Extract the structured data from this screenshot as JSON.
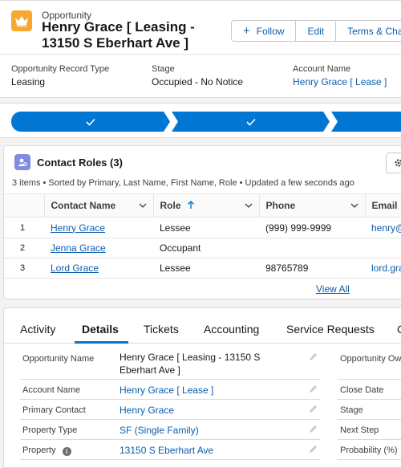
{
  "header": {
    "object_label": "Opportunity",
    "title": "Henry Grace [ Leasing - 13150 S Eberhart Ave ]",
    "buttons": {
      "follow": "Follow",
      "edit": "Edit",
      "terms": "Terms & Cha"
    },
    "fields": [
      {
        "label": "Opportunity Record Type",
        "value": "Leasing"
      },
      {
        "label": "Stage",
        "value": "Occupied - No Notice"
      },
      {
        "label": "Account Name",
        "value": "Henry Grace [ Lease ]"
      }
    ],
    "icon": "crown-icon",
    "accent_color": "#f6a830"
  },
  "path": {
    "steps_complete": 3,
    "color": "#0176d3"
  },
  "contact_roles": {
    "title": "Contact Roles (3)",
    "meta": "3 items • Sorted by Primary, Last Name, First Name, Role • Updated a few seconds ago",
    "columns": [
      "Contact Name",
      "Role",
      "Phone",
      "Email"
    ],
    "rows": [
      {
        "num": "1",
        "name": "Henry Grace",
        "role": "Lessee",
        "phone": "(999) 999-9999",
        "email": "henry@"
      },
      {
        "num": "2",
        "name": "Jenna Grace",
        "role": "Occupant",
        "phone": "",
        "email": ""
      },
      {
        "num": "3",
        "name": "Lord Grace",
        "role": "Lessee",
        "phone": "98765789",
        "email": "lord.gra"
      }
    ],
    "view_all": "View All",
    "icon_color": "#7f8de1"
  },
  "details": {
    "tabs": [
      "Activity",
      "Details",
      "Tickets",
      "Accounting",
      "Service Requests",
      "C"
    ],
    "active_tab": "Details",
    "left_fields": [
      {
        "label": "Opportunity Name",
        "value_line1": "Henry Grace [ Leasing - 13150 S",
        "value_line2": "Eberhart Ave ]"
      },
      {
        "label": "Account Name",
        "value": "Henry Grace [ Lease ]"
      },
      {
        "label": "Primary Contact",
        "value": "Henry Grace"
      },
      {
        "label": "Property Type",
        "value": "SF (Single Family)"
      },
      {
        "label": "Property",
        "value": "13150 S Eberhart Ave"
      }
    ],
    "right_fields": [
      "Opportunity Ow",
      "Close Date",
      "Stage",
      "Next Step",
      "Probability (%)"
    ]
  }
}
